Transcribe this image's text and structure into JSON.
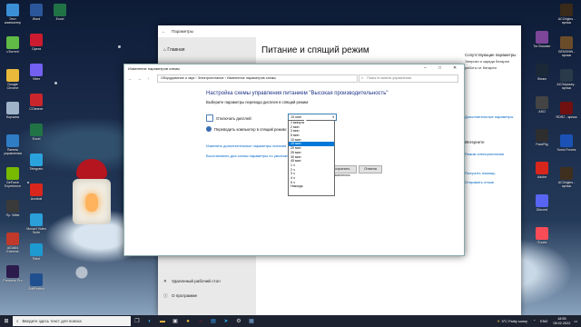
{
  "desktop": {
    "left_icons": [
      {
        "label": "Этот компьютер",
        "icon": "computer-icon",
        "color": "#3b8fd6"
      },
      {
        "label": "uTorrent",
        "icon": "utorrent-icon",
        "color": "#5fba46"
      },
      {
        "label": "Google Chrome",
        "icon": "chrome-icon",
        "color": "#e8b93a"
      },
      {
        "label": "Корзина",
        "icon": "recycle-bin-icon",
        "color": "#9fb3c8"
      },
      {
        "label": "Панель управления",
        "icon": "control-panel-icon",
        "color": "#2f7dc4"
      },
      {
        "label": "GeForce Experience",
        "icon": "nvidia-icon",
        "color": "#76b900"
      },
      {
        "label": "Пр. Wide",
        "icon": "app-icon",
        "color": "#3a3a3a"
      },
      {
        "label": "AIDA64 Extreme",
        "icon": "aida64-icon",
        "color": "#c0392b"
      },
      {
        "label": "Premiere Pro",
        "icon": "premiere-icon",
        "color": "#2c1b4d"
      }
    ],
    "second_column": [
      {
        "label": "Word",
        "icon": "word-icon",
        "color": "#2b579a"
      },
      {
        "label": "Opera",
        "icon": "opera-icon",
        "color": "#cc1b2f"
      },
      {
        "label": "Viber",
        "icon": "viber-icon",
        "color": "#7360f2"
      },
      {
        "label": "CCleaner",
        "icon": "ccleaner-icon",
        "color": "#c8252c"
      },
      {
        "label": "Excel",
        "icon": "excel-icon",
        "color": "#217346"
      },
      {
        "label": "Telegram",
        "icon": "telegram-icon",
        "color": "#2aa3dd"
      },
      {
        "label": "Acrobat",
        "icon": "acrobat-icon",
        "color": "#d9261c"
      },
      {
        "label": "Movavi Video Suite",
        "icon": "movavi-icon",
        "color": "#2a9fd8"
      },
      {
        "label": "Paint",
        "icon": "paint-icon",
        "color": "#1d9bd1"
      },
      {
        "label": "SoftPerfect",
        "icon": "app-icon",
        "color": "#1f4f8f"
      }
    ],
    "third_column": [
      {
        "label": "Excel",
        "icon": "excel-icon",
        "color": "#217346"
      }
    ],
    "right_icons": [
      {
        "label": "Tor Browser",
        "icon": "tor-icon",
        "color": "#7d4698"
      },
      {
        "label": "Steam",
        "icon": "steam-icon",
        "color": "#1b2838"
      },
      {
        "label": "ASO",
        "icon": "app-icon",
        "color": "#444"
      },
      {
        "label": "FaceRig",
        "icon": "facerig-icon",
        "color": "#2e2e2e"
      },
      {
        "label": "Adobe",
        "icon": "adobe-icon",
        "color": "#d9261c"
      },
      {
        "label": "Discord",
        "icon": "discord-icon",
        "color": "#5865f2"
      },
      {
        "label": "iTunes",
        "icon": "itunes-icon",
        "color": "#f94c57"
      }
    ],
    "far_right_icons": [
      {
        "label": "ACOrigins - ярлык",
        "icon": "game-icon",
        "color": "#3a2a1a"
      },
      {
        "label": "GENSHIN - ярлык",
        "icon": "game-icon",
        "color": "#6b4c2a"
      },
      {
        "label": "ACOdyssey - ярлык",
        "icon": "game-icon",
        "color": "#2a3a4a"
      },
      {
        "label": "RDR2 - ярлык",
        "icon": "game-icon",
        "color": "#701010"
      },
      {
        "label": "Sonic Forces",
        "icon": "game-icon",
        "color": "#1c52b5"
      },
      {
        "label": "ACOrigins - ярлык",
        "icon": "game-icon",
        "color": "#3f2f1f"
      }
    ]
  },
  "settings": {
    "title": "Параметры",
    "home": "Главная",
    "heading": "Питание и спящий режим",
    "side_items": [
      "Удаленный рабочий стол",
      "О программе"
    ],
    "related": {
      "line1": "Сопутствующие параметры",
      "line2": "Энергии и заряда батареи",
      "line3": "работы от батареи",
      "link1": "Дополнительные параметры",
      "head2": "Интернете",
      "link2": "Режим электропитания",
      "link3": "Получить помощь",
      "link4": "Отправить отзыв"
    }
  },
  "control_panel": {
    "title": "Изменение параметров схемы",
    "breadcrumb": "Оборудование и звук  ›  Электропитание  ›  Изменение параметров схемы",
    "search_placeholder": "Поиск в панели управления",
    "page_title": "Настройка схемы управления питанием \"Высокая производительность\"",
    "subtitle": "Выберите параметры перевода дисплея в спящий режим",
    "display_label": "Отключать дисплей:",
    "sleep_label": "Переводить компьютер в спящий режим:",
    "display_value": "15 мин",
    "link_advanced": "Изменить дополнительные параметры питания",
    "link_restore": "Восстановить для схемы параметры по умолчанию",
    "save_btn": "Сохранить изменения",
    "cancel_btn": "Отмена",
    "dropdown_options": [
      "1 минута",
      "2 мин",
      "3 мин",
      "5 мин",
      "10 мин",
      "15 мин",
      "20 мин",
      "25 мин",
      "30 мин",
      "45 мин",
      "1 ч",
      "2 ч",
      "3 ч",
      "4 ч",
      "5 ч",
      "Никогда"
    ],
    "selected_index": 5
  },
  "taskbar": {
    "search_placeholder": "Введите здесь текст для поиска",
    "weather": "5°C  Partly sunny",
    "time": "18:55",
    "date": "08.02.2022",
    "lang": "ENG"
  }
}
